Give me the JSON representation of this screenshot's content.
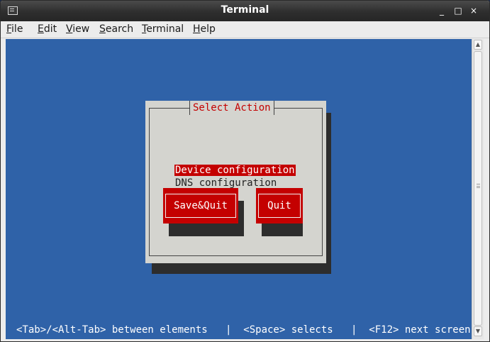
{
  "window": {
    "title": "Terminal",
    "minimize_label": "_",
    "maximize_label": "□",
    "close_label": "×"
  },
  "menubar": {
    "items": [
      {
        "accel": "F",
        "rest": "ile"
      },
      {
        "accel": "E",
        "rest": "dit"
      },
      {
        "accel": "V",
        "rest": "iew"
      },
      {
        "accel": "S",
        "rest": "earch"
      },
      {
        "accel": "T",
        "rest": "erminal"
      },
      {
        "accel": "H",
        "rest": "elp"
      }
    ]
  },
  "dialog": {
    "title": "Select Action",
    "options": [
      {
        "label": "Device configuration",
        "selected": true
      },
      {
        "label": "DNS configuration",
        "selected": false
      }
    ],
    "buttons": {
      "save_quit": "Save&Quit",
      "quit": "Quit"
    }
  },
  "status_bar": "<Tab>/<Alt-Tab> between elements   |  <Space> selects   |  <F12> next screen",
  "colors": {
    "terminal_bg": "#2f62a8",
    "dialog_bg": "#d4d4cf",
    "accent_red": "#c40000",
    "shadow": "#2d2d2d"
  },
  "icons": {
    "app": "terminal-icon",
    "scroll_up": "arrow-up-icon",
    "scroll_down": "arrow-down-icon"
  }
}
